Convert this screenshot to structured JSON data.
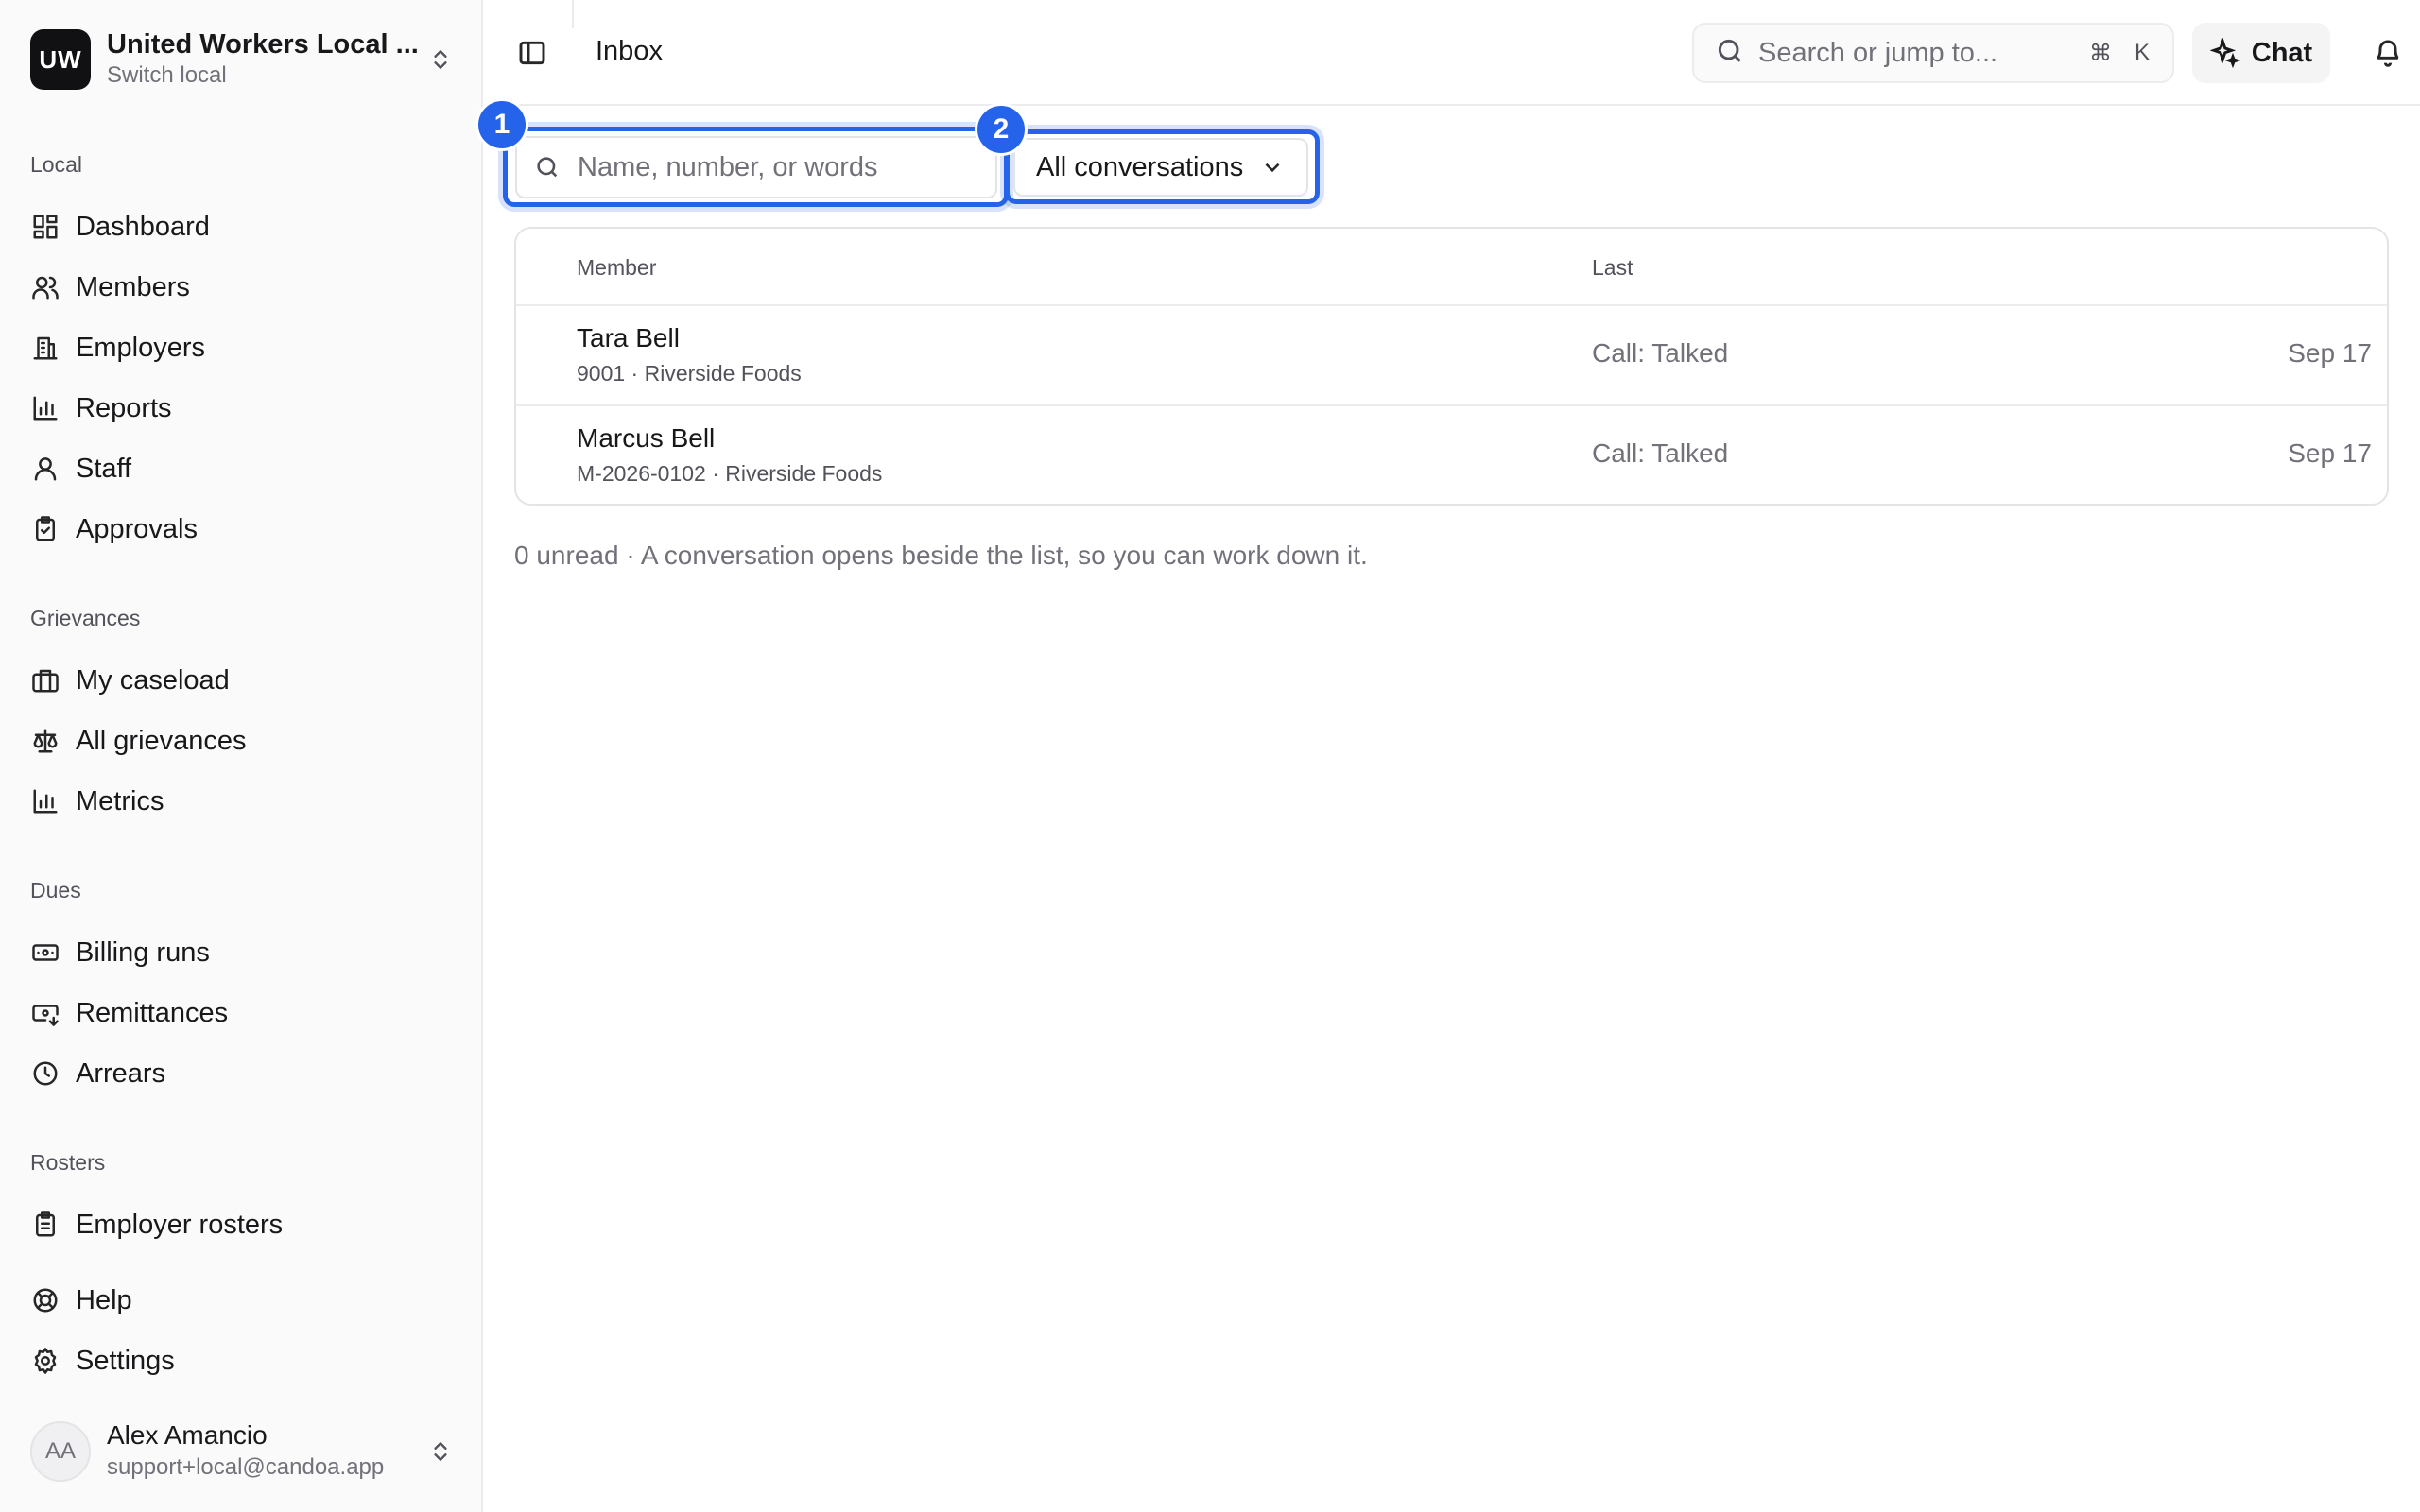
{
  "org": {
    "initials": "UW",
    "name": "United Workers Local ...",
    "subtitle": "Switch local"
  },
  "sidebar": {
    "sections": {
      "local": "Local",
      "grievances": "Grievances",
      "dues": "Dues",
      "rosters": "Rosters"
    },
    "local_items": [
      "Dashboard",
      "Members",
      "Employers",
      "Reports",
      "Staff",
      "Approvals"
    ],
    "grievance_items": [
      "My caseload",
      "All grievances",
      "Metrics"
    ],
    "dues_items": [
      "Billing runs",
      "Remittances",
      "Arrears"
    ],
    "roster_items": [
      "Employer rosters"
    ],
    "footer_items": [
      "Help",
      "Settings"
    ]
  },
  "user": {
    "initials": "AA",
    "name": "Alex Amancio",
    "email": "support+local@candoa.app"
  },
  "header": {
    "breadcrumb": "Inbox",
    "search_placeholder": "Search or jump to...",
    "shortcut_cmd": "⌘",
    "shortcut_key": "K",
    "chat_label": "Chat"
  },
  "filters": {
    "search_placeholder": "Name, number, or words",
    "select_value": "All conversations",
    "badge_1": "1",
    "badge_2": "2"
  },
  "table": {
    "columns": [
      "Member",
      "Last"
    ],
    "rows": [
      {
        "name": "Tara Bell",
        "sub": "9001 · Riverside Foods",
        "last": "Call: Talked",
        "date": "Sep 17"
      },
      {
        "name": "Marcus Bell",
        "sub": "M-2026-0102 · Riverside Foods",
        "last": "Call: Talked",
        "date": "Sep 17"
      }
    ]
  },
  "footnote": "0 unread · A conversation opens beside the list, so you can work down it.",
  "colors": {
    "accent": "#2563eb",
    "logo_bg": "#111113",
    "sidebar_bg": "#fafafa"
  }
}
